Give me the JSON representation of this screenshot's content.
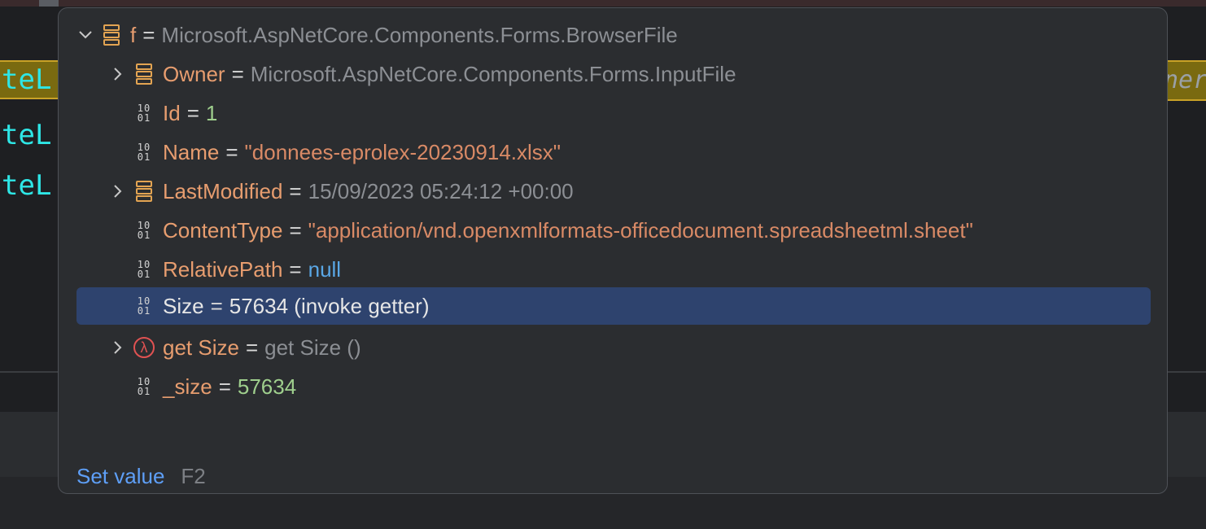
{
  "editor": {
    "code_lines": [
      "teL",
      "teL",
      "teL"
    ],
    "right_fragment": "ner"
  },
  "popup": {
    "root": {
      "name": "f",
      "eq": "=",
      "value": "Microsoft.AspNetCore.Components.Forms.BrowserFile"
    },
    "items": [
      {
        "name": "Owner",
        "eq": "=",
        "value": "Microsoft.AspNetCore.Components.Forms.InputFile",
        "icon": "object-icon",
        "expandable": true
      },
      {
        "name": "Id",
        "eq": "=",
        "value": "1",
        "icon": "primitive-field-icon",
        "expandable": false
      },
      {
        "name": "Name",
        "eq": "=",
        "value": "\"donnees-eprolex-20230914.xlsx\"",
        "icon": "primitive-field-icon",
        "expandable": false
      },
      {
        "name": "LastModified",
        "eq": "=",
        "value": "15/09/2023 05:24:12 +00:00",
        "icon": "object-icon",
        "expandable": true
      },
      {
        "name": "ContentType",
        "eq": "=",
        "value": "\"application/vnd.openxmlformats-officedocument.spreadsheetml.sheet\"",
        "icon": "primitive-field-icon",
        "expandable": false
      },
      {
        "name": "RelativePath",
        "eq": "=",
        "value": "null",
        "icon": "primitive-field-icon",
        "expandable": false
      },
      {
        "name": "Size",
        "eq": "=",
        "value": "57634  (invoke getter)",
        "icon": "primitive-field-icon",
        "expandable": false,
        "selected": true
      },
      {
        "name": "get Size",
        "eq": "=",
        "value": "get Size ()",
        "icon": "lambda-icon",
        "expandable": true
      },
      {
        "name": "_size",
        "eq": "=",
        "value": "57634",
        "icon": "primitive-field-icon",
        "expandable": false
      }
    ],
    "footer": {
      "action": "Set value",
      "shortcut": "F2"
    },
    "icon_glyphs": {
      "binary_top": "10",
      "binary_bottom": "01",
      "lambda": "λ"
    }
  }
}
